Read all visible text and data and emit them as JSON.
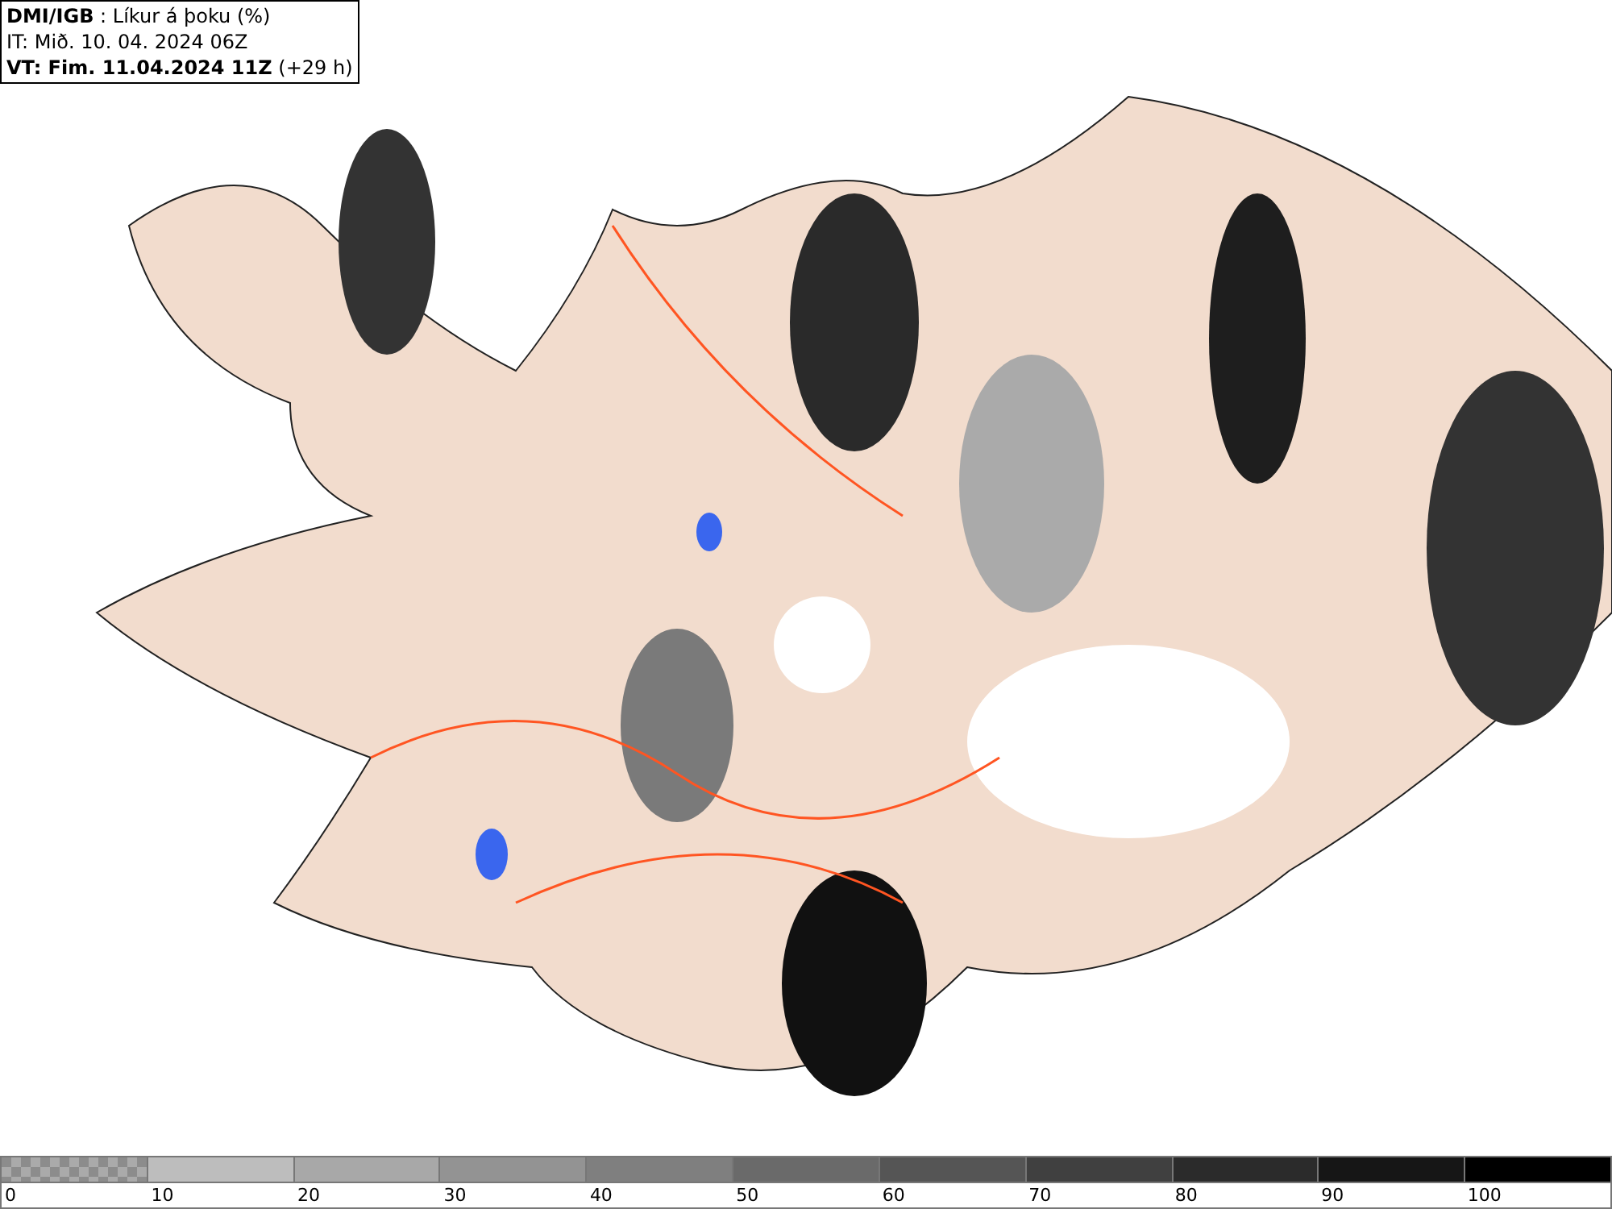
{
  "header": {
    "lines": [
      "**DMI/IGB** : Líkur á þoku (%)",
      "IT: Mið. 10. 04. 2024 06Z",
      "**VT: Fim. 11.04.2024 11Z** (+29 h)"
    ]
  },
  "legend": {
    "segments": [
      {
        "kind": "checker",
        "color": "#8c8c8c"
      },
      {
        "kind": "solid",
        "color": "#bdbdbd"
      },
      {
        "kind": "solid",
        "color": "#a8a8a8"
      },
      {
        "kind": "solid",
        "color": "#939393"
      },
      {
        "kind": "solid",
        "color": "#7f7f7f"
      },
      {
        "kind": "solid",
        "color": "#6a6a6a"
      },
      {
        "kind": "solid",
        "color": "#555555"
      },
      {
        "kind": "solid",
        "color": "#404040"
      },
      {
        "kind": "solid",
        "color": "#2b2b2b"
      },
      {
        "kind": "solid",
        "color": "#161616"
      },
      {
        "kind": "solid",
        "color": "#000000"
      }
    ],
    "labels": [
      "0",
      "10",
      "20",
      "30",
      "40",
      "50",
      "60",
      "70",
      "80",
      "90",
      "100"
    ]
  }
}
